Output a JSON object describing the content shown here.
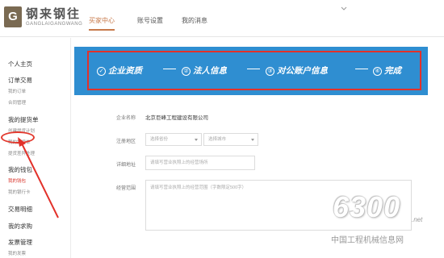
{
  "header": {
    "logo_text": "钢来钢往",
    "logo_sub": "GANGLAIGANGWANG",
    "logo_mark": "G",
    "nav": [
      "买家中心",
      "账号设置",
      "我的消息"
    ]
  },
  "sidebar": {
    "items": [
      {
        "label": "个人主页",
        "kind": "heading"
      },
      {
        "label": "订单交易",
        "kind": "heading"
      },
      {
        "label": "我的订单",
        "kind": "sub"
      },
      {
        "label": "合同管理",
        "kind": "sub"
      },
      {
        "label": "我的提货单",
        "kind": "heading"
      },
      {
        "label": "创建提货计划",
        "kind": "sub"
      },
      {
        "label": "我的提货单",
        "kind": "sub"
      },
      {
        "label": "提货差异处理",
        "kind": "sub"
      },
      {
        "label": "我的钱包",
        "kind": "heading"
      },
      {
        "label": "我的钱包",
        "kind": "sub",
        "highlight": true
      },
      {
        "label": "我的银行卡",
        "kind": "sub"
      },
      {
        "label": "交易明细",
        "kind": "heading"
      },
      {
        "label": "我的求购",
        "kind": "heading"
      },
      {
        "label": "发票管理",
        "kind": "heading"
      },
      {
        "label": "我的发票",
        "kind": "sub"
      }
    ]
  },
  "steps": [
    {
      "num": "✓",
      "label": "企业资质"
    },
    {
      "num": "②",
      "label": "法人信息"
    },
    {
      "num": "③",
      "label": "对公账户信息"
    },
    {
      "num": "④",
      "label": "完成"
    }
  ],
  "form": {
    "company_label": "企业名称",
    "company_value": "北京巨峰工程建设有限公司",
    "region_label": "注册地区",
    "province_placeholder": "选择省份",
    "city_placeholder": "选择城市",
    "address_label": "详细地址",
    "address_placeholder": "请填写营业执照上的经营场所",
    "scope_label": "经营范围",
    "scope_placeholder": "请填写营业执照上的经营范围（字数限定500字）"
  },
  "watermark": {
    "number": "6300",
    "dotnet": ".net",
    "site": "中国工程机械信息网"
  },
  "colors": {
    "brand": "#7a6a52",
    "active_tab": "#c7794a",
    "steps_bg": "#2f8ed1",
    "annotation_red": "#e2312a"
  }
}
